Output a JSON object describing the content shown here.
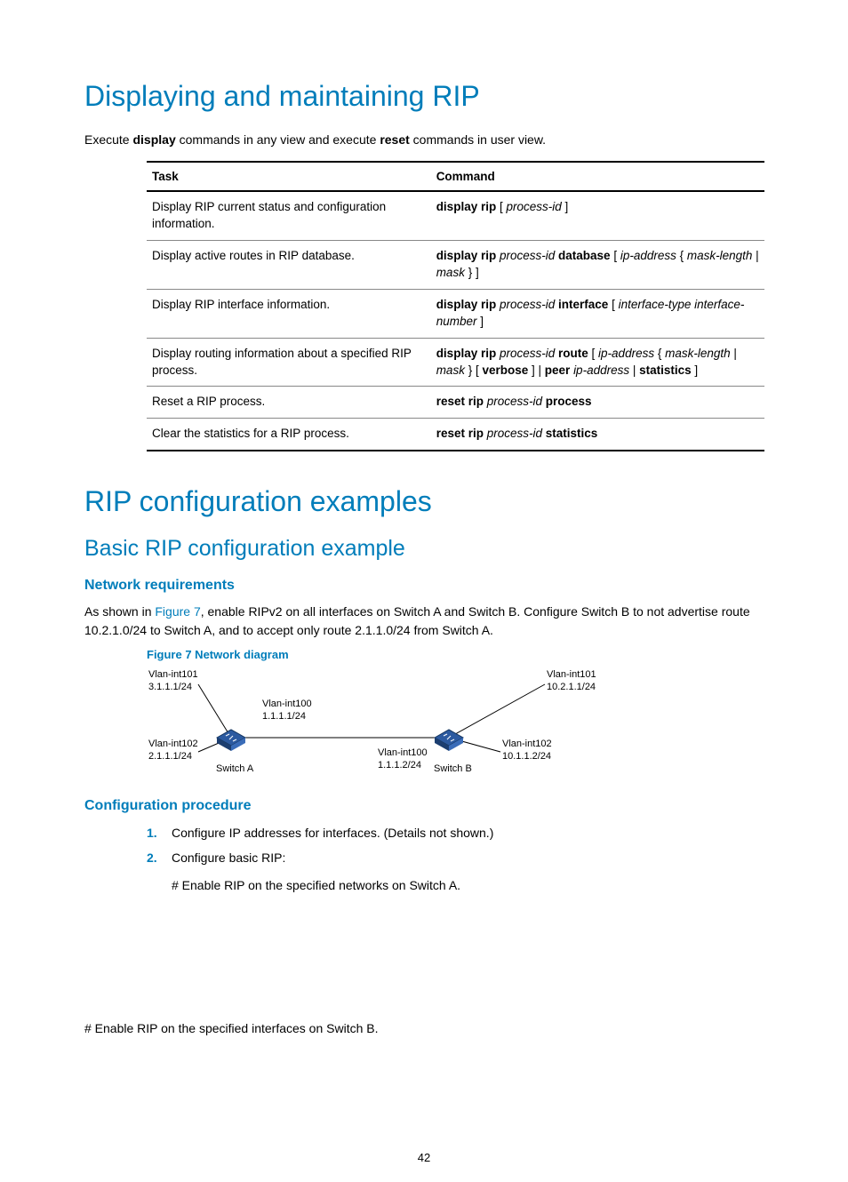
{
  "h1a": "Displaying and maintaining RIP",
  "intro": {
    "pre": "Execute ",
    "b1": "display",
    "mid": " commands in any view and execute ",
    "b2": "reset",
    "post": " commands in user view."
  },
  "table": {
    "head": {
      "task": "Task",
      "command": "Command"
    },
    "rows": [
      {
        "task": "Display RIP current status and configuration information.",
        "cmd": [
          {
            "b": true,
            "t": "display rip"
          },
          {
            "t": " [ "
          },
          {
            "i": true,
            "t": "process-id"
          },
          {
            "t": " ]"
          }
        ]
      },
      {
        "task": "Display active routes in RIP database.",
        "cmd": [
          {
            "b": true,
            "t": "display rip"
          },
          {
            "t": " "
          },
          {
            "i": true,
            "t": "process-id"
          },
          {
            "t": " "
          },
          {
            "b": true,
            "t": "database"
          },
          {
            "t": " [ "
          },
          {
            "i": true,
            "t": "ip-address"
          },
          {
            "t": " { "
          },
          {
            "i": true,
            "t": "mask-length"
          },
          {
            "t": " | "
          },
          {
            "i": true,
            "t": "mask"
          },
          {
            "t": " } ]"
          }
        ]
      },
      {
        "task": "Display RIP interface information.",
        "cmd": [
          {
            "b": true,
            "t": "display rip"
          },
          {
            "t": " "
          },
          {
            "i": true,
            "t": "process-id"
          },
          {
            "t": " "
          },
          {
            "b": true,
            "t": "interface"
          },
          {
            "t": " [ "
          },
          {
            "i": true,
            "t": "interface-type interface-number"
          },
          {
            "t": " ]"
          }
        ]
      },
      {
        "task": "Display routing information about a specified RIP process.",
        "cmd": [
          {
            "b": true,
            "t": "display rip"
          },
          {
            "t": " "
          },
          {
            "i": true,
            "t": "process-id"
          },
          {
            "t": " "
          },
          {
            "b": true,
            "t": "route"
          },
          {
            "t": " [ "
          },
          {
            "i": true,
            "t": "ip-address"
          },
          {
            "t": " { "
          },
          {
            "i": true,
            "t": "mask-length"
          },
          {
            "t": " | "
          },
          {
            "i": true,
            "t": "mask"
          },
          {
            "t": " } [ "
          },
          {
            "b": true,
            "t": "verbose"
          },
          {
            "t": " ] | "
          },
          {
            "b": true,
            "t": "peer"
          },
          {
            "t": " "
          },
          {
            "i": true,
            "t": "ip-address"
          },
          {
            "t": " | "
          },
          {
            "b": true,
            "t": "statistics"
          },
          {
            "t": " ]"
          }
        ]
      },
      {
        "task": "Reset a RIP process.",
        "cmd": [
          {
            "b": true,
            "t": "reset rip"
          },
          {
            "t": " "
          },
          {
            "i": true,
            "t": "process-id"
          },
          {
            "t": " "
          },
          {
            "b": true,
            "t": "process"
          }
        ]
      },
      {
        "task": "Clear the statistics for a RIP process.",
        "cmd": [
          {
            "b": true,
            "t": "reset rip"
          },
          {
            "t": " "
          },
          {
            "i": true,
            "t": "process-id"
          },
          {
            "t": " "
          },
          {
            "b": true,
            "t": "statistics"
          }
        ]
      }
    ]
  },
  "h1b": "RIP configuration examples",
  "h2a": "Basic RIP configuration example",
  "h3a": "Network requirements",
  "req": {
    "pre": "As shown in ",
    "link": "Figure 7",
    "post": ", enable RIPv2 on all interfaces on Switch A and Switch B. Configure Switch B to not advertise route 10.2.1.0/24 to Switch A, and to accept only route 2.1.1.0/24 from Switch A."
  },
  "figcap": "Figure 7 Network diagram",
  "diagram": {
    "a": {
      "int101": "Vlan-int101",
      "ip101": "3.1.1.1/24",
      "int100": "Vlan-int100",
      "ip100": "1.1.1.1/24",
      "int102": "Vlan-int102",
      "ip102": "2.1.1.1/24",
      "name": "Switch A"
    },
    "b": {
      "int101": "Vlan-int101",
      "ip101": "10.2.1.1/24",
      "int100": "Vlan-int100",
      "ip100": "1.1.1.2/24",
      "int102": "Vlan-int102",
      "ip102": "10.1.1.2/24",
      "name": "Switch B"
    }
  },
  "h3b": "Configuration procedure",
  "steps": {
    "s1": "Configure IP addresses for interfaces. (Details not shown.)",
    "s2": "Configure basic RIP:",
    "s2a": "# Enable RIP on the specified networks on Switch A.",
    "s2b": "# Enable RIP on the specified interfaces on Switch B."
  },
  "pagenum": "42"
}
